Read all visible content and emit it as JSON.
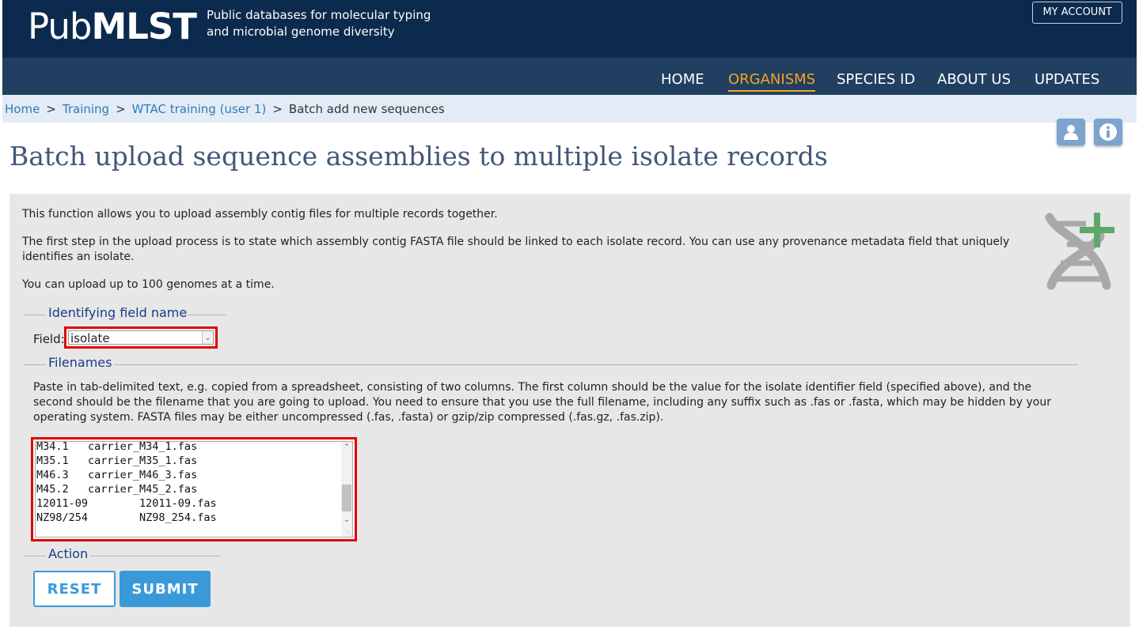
{
  "header": {
    "logo_light": "Pub",
    "logo_bold": "MLST",
    "tagline_line1": "Public databases for molecular typing",
    "tagline_line2": "and microbial genome diversity",
    "account_button": "MY ACCOUNT"
  },
  "nav": {
    "items": [
      {
        "label": "HOME"
      },
      {
        "label": "ORGANISMS"
      },
      {
        "label": "SPECIES ID"
      },
      {
        "label": "ABOUT US"
      },
      {
        "label": "UPDATES"
      }
    ],
    "active": "ORGANISMS"
  },
  "breadcrumb": {
    "items": [
      "Home",
      "Training",
      "WTAC training (user 1)"
    ],
    "separator": ">",
    "current": "Batch add new sequences"
  },
  "page": {
    "title": "Batch upload sequence assemblies to multiple isolate records",
    "para1": "This function allows you to upload assembly contig files for multiple records together.",
    "para2": "The first step in the upload process is to state which assembly contig FASTA file should be linked to each isolate record. You can use any provenance metadata field that uniquely identifies an isolate.",
    "para3": "You can upload up to 100 genomes at a time."
  },
  "identifying": {
    "legend": "Identifying field name",
    "field_label": "Field:",
    "selected": "isolate"
  },
  "filenames": {
    "legend": "Filenames",
    "description": "Paste in tab-delimited text, e.g. copied from a spreadsheet, consisting of two columns. The first column should be the value for the isolate identifier field (specified above), and the second should be the filename that you are going to upload. You need to ensure that you use the full filename, including any suffix such as .fas or .fasta, which may be hidden by your operating system. FASTA files may be either uncompressed (.fas, .fasta) or gzip/zip compressed (.fas.gz, .fas.zip).",
    "lines": [
      "M34.1   carrier_M34_1.fas",
      "M35.1   carrier_M35_1.fas",
      "M46.3   carrier_M46_3.fas",
      "M45.2   carrier_M45_2.fas",
      "12011-09        12011-09.fas",
      "NZ98/254        NZ98_254.fas"
    ]
  },
  "action": {
    "legend": "Action",
    "reset_label": "RESET",
    "submit_label": "SUBMIT"
  },
  "colors": {
    "header_bg": "#0b2a4d",
    "nav_bg": "#213f61",
    "nav_active": "#f5a524",
    "button_blue": "#3a9ad9",
    "highlight_red": "#e00000"
  }
}
